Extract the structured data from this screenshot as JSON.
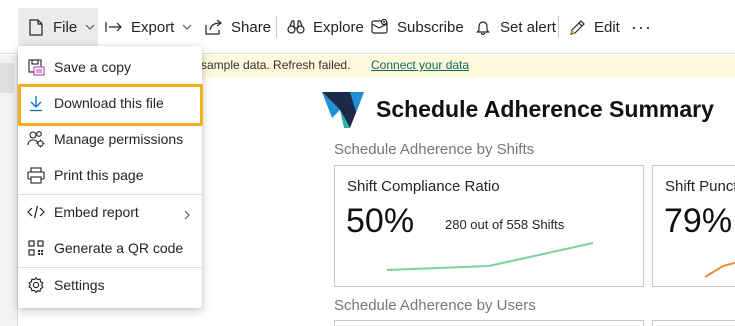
{
  "toolbar": {
    "file_label": "File",
    "export_label": "Export",
    "share_label": "Share",
    "explore_label": "Explore",
    "subscribe_label": "Subscribe",
    "set_alert_label": "Set alert",
    "edit_label": "Edit",
    "more_label": "···"
  },
  "notification": {
    "text": "sample data. Refresh failed.",
    "link": "Connect your data"
  },
  "file_menu": {
    "items": [
      {
        "label": "Save a copy",
        "icon": "save-copy-icon"
      },
      {
        "label": "Download this file",
        "icon": "download-icon",
        "highlighted": true
      },
      {
        "label": "Manage permissions",
        "icon": "manage-permissions-icon"
      },
      {
        "label": "Print this page",
        "icon": "print-icon"
      },
      {
        "label": "Embed report",
        "icon": "embed-code-icon",
        "has_submenu": true
      },
      {
        "label": "Generate a QR code",
        "icon": "qr-code-icon"
      },
      {
        "label": "Settings",
        "icon": "gear-icon"
      }
    ],
    "highlight_color": "#f2b01e"
  },
  "report": {
    "title": "Schedule Adherence Summary",
    "section1_label": "Schedule Adherence by Shifts",
    "section2_label": "Schedule Adherence by Users",
    "cards": [
      {
        "title": "Shift Compliance Ratio",
        "value": "50%",
        "subtitle": "280 out of 558 Shifts",
        "sparkline_color": "#7fd39a"
      },
      {
        "title": "Shift Punct",
        "value": "79%",
        "sparkline_color": "#f08a3c"
      }
    ]
  },
  "colors": {
    "notification_bg": "#fef8dc",
    "link": "#0f6b5c",
    "logo_dark": "#1b2a4a",
    "logo_blue": "#1f8fd8",
    "logo_teal": "#27b3a6"
  }
}
